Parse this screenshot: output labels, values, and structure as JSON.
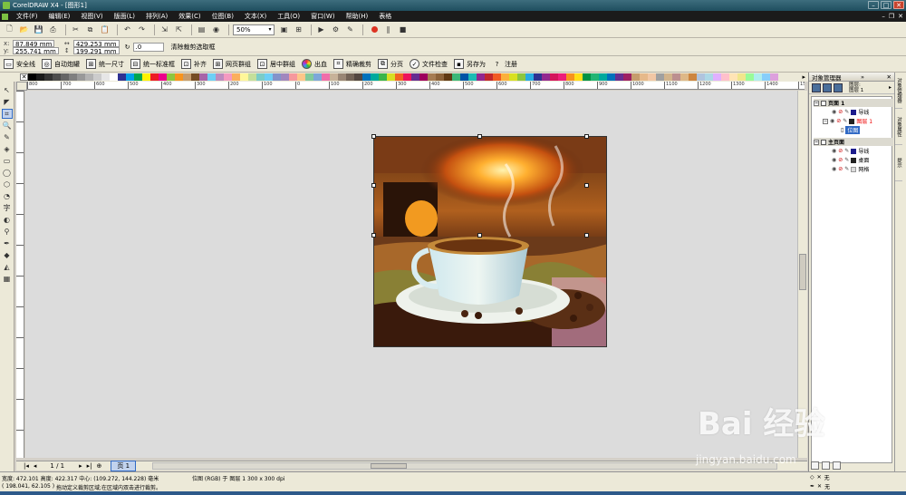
{
  "titlebar": {
    "title": "CorelDRAW X4 - [图形1]"
  },
  "menubar": {
    "items": [
      "文件(F)",
      "编辑(E)",
      "视图(V)",
      "版面(L)",
      "排列(A)",
      "效果(C)",
      "位图(B)",
      "文本(X)",
      "工具(O)",
      "窗口(W)",
      "帮助(H)",
      "表格"
    ]
  },
  "standard_toolbar": {
    "zoom_value": "50%"
  },
  "property_bar": {
    "x": "87.849 mm",
    "y": "255.741 mm",
    "width": "429.253 mm",
    "height": "199.291 mm",
    "rotation": ".0",
    "clear_crop_label": "清除裁剪选取框"
  },
  "plugin_toolbar": {
    "buttons": [
      {
        "label": "安全线",
        "icon": "safety-line-icon"
      },
      {
        "label": "自动炮罐",
        "icon": "auto-icon"
      },
      {
        "label": "统一尺寸",
        "icon": "uniform-size-icon"
      },
      {
        "label": "统一标准框",
        "icon": "standard-frame-icon"
      },
      {
        "label": "补齐",
        "icon": "fill-icon"
      },
      {
        "label": "网页群组",
        "icon": "web-group-icon"
      },
      {
        "label": "居中群组",
        "icon": "center-group-icon"
      },
      {
        "label": "出血",
        "icon": "bleed-icon"
      },
      {
        "label": "精确裁剪",
        "icon": "precise-crop-icon"
      },
      {
        "label": "分页",
        "icon": "paging-icon"
      },
      {
        "label": "文件检查",
        "icon": "file-check-icon"
      },
      {
        "label": "另存为",
        "icon": "save-as-icon"
      },
      {
        "label": "注册",
        "icon": "register-icon"
      }
    ]
  },
  "palette": {
    "colors": [
      "#000000",
      "#1a1a1a",
      "#333333",
      "#4d4d4d",
      "#666666",
      "#808080",
      "#999999",
      "#b3b3b3",
      "#cccccc",
      "#e6e6e6",
      "#ffffff",
      "#2e3192",
      "#00a0e9",
      "#00a650",
      "#fff200",
      "#ed1c24",
      "#ec008c",
      "#8dc63f",
      "#f7941d",
      "#c69c6d",
      "#754c24",
      "#a864a8",
      "#6dcff6",
      "#bd8cbf",
      "#f49ac1",
      "#fbaf5d",
      "#fff799",
      "#c4df9b",
      "#7accc8",
      "#6ecff6",
      "#8393ca",
      "#a187be",
      "#f6989d",
      "#fdc689",
      "#82ca9c",
      "#7da7d9",
      "#f06eaa",
      "#c7b299",
      "#998675",
      "#736357",
      "#534741",
      "#0072bc",
      "#00a99d",
      "#39b54a",
      "#d7df23",
      "#f26522",
      "#ed145b",
      "#662d91",
      "#9e005d",
      "#a67c52",
      "#8c6239",
      "#603913",
      "#3cb878",
      "#0054a6",
      "#1cbbb4",
      "#92278f",
      "#c1272d",
      "#f15a24",
      "#fbb03b",
      "#d9e021",
      "#8cc63f",
      "#29abe2",
      "#2e3192",
      "#93278f",
      "#d4145a",
      "#ed1e79",
      "#f7931e",
      "#ffde17",
      "#009245",
      "#22b573",
      "#00a99d",
      "#0071bc",
      "#662d91",
      "#9e1f63",
      "#c69c6d",
      "#e6b98a",
      "#f2c7a5",
      "#a0a0a0",
      "#d2b48c",
      "#bc8f8f",
      "#deb887",
      "#cd853f",
      "#b0c4de",
      "#add8e6",
      "#e0b0ff",
      "#ffc0cb",
      "#ffe4b5",
      "#f0e68c",
      "#98fb98",
      "#afeeee",
      "#87cefa",
      "#dda0dd"
    ]
  },
  "ruler": {
    "h_ticks": [
      "800",
      "700",
      "600",
      "500",
      "400",
      "300",
      "200",
      "100",
      "0",
      "100",
      "200",
      "300",
      "400",
      "500",
      "600",
      "700",
      "800",
      "900",
      "1000",
      "1100",
      "1200",
      "1300",
      "1400",
      "1500"
    ],
    "v_ticks": [
      "800",
      "700",
      "600",
      "500",
      "400",
      "300",
      "200",
      "100",
      "0",
      "-100",
      "-200",
      "-300"
    ]
  },
  "page_nav": {
    "counter": "1 / 1",
    "tab_label": "页 1"
  },
  "status": {
    "dimensions": "宽度: 472.101  高度: 422.317  中心: (109.272, 144.228)  毫米",
    "object_info": "位图 (RGB) 于 图层 1 300 x 300 dpi",
    "cursor": "( 198.041, 62.105 )",
    "hint": "拖动定义裁剪区域;在区域内双击进行裁剪。",
    "fill_value": "无",
    "outline_value": "无"
  },
  "object_manager": {
    "title": "对象管理器",
    "layer_info": [
      "图层:",
      "图层 1"
    ],
    "tree": [
      {
        "type": "page",
        "label": "页面 1"
      },
      {
        "type": "layer",
        "label": "导线",
        "color": "#1c1c8c"
      },
      {
        "type": "layer",
        "label": "图层 1",
        "color": "#222222",
        "red": true
      },
      {
        "type": "object",
        "label": "位图",
        "selected": true
      },
      {
        "type": "page",
        "label": "主页面"
      },
      {
        "type": "layer",
        "label": "导线",
        "color": "#1c1c8c"
      },
      {
        "type": "layer",
        "label": "桌面",
        "color": "#222222"
      },
      {
        "type": "layer",
        "label": "网格",
        "color": "#dcdcdc"
      }
    ]
  },
  "dock_tabs": [
    "对象管理器",
    "对象属性",
    "提示"
  ],
  "watermark": {
    "main": "Bai 经验",
    "sub": "jingyan.baidu.com"
  }
}
